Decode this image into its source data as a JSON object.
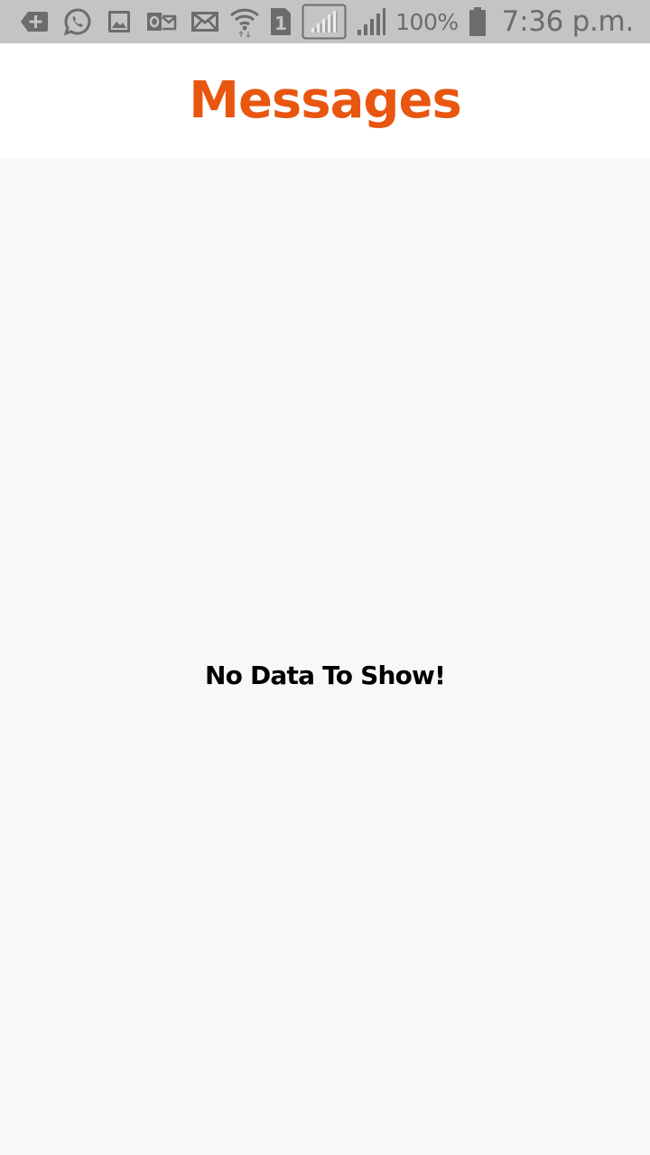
{
  "status_bar": {
    "notification_icons": [
      "add-box-icon",
      "whatsapp-icon",
      "image-icon",
      "outlook-icon",
      "mail-icon"
    ],
    "system_icons": [
      "wifi-icon",
      "sim-1-icon",
      "signal-icon",
      "signal-icon",
      "battery-icon"
    ],
    "battery_percent": "100%",
    "clock": "7:36 p.m."
  },
  "header": {
    "title": "Messages"
  },
  "main": {
    "empty_text": "No Data To Show!"
  },
  "colors": {
    "status_bar_bg": "#c4c4c4",
    "status_icon": "#6c6c6c",
    "header_bg": "#ffffff",
    "accent": "#e8560f",
    "content_bg": "#f8f8f8",
    "text": "#000000"
  }
}
